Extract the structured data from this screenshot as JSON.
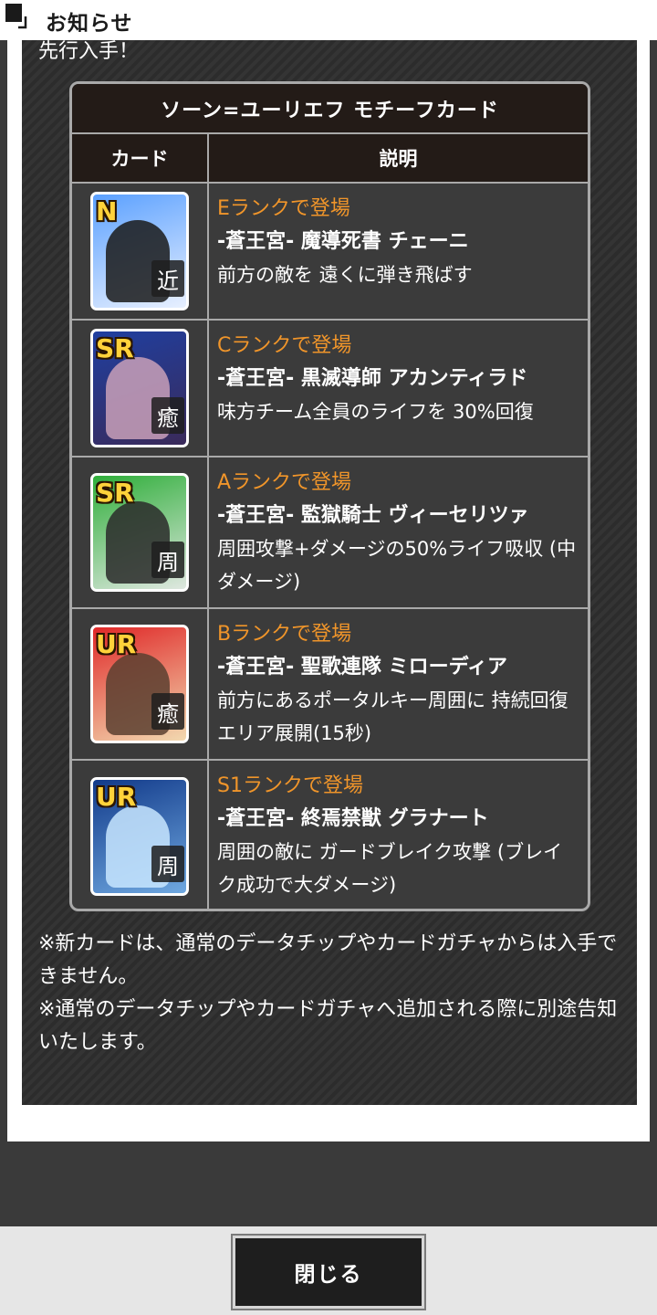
{
  "header": {
    "title": "お知らせ"
  },
  "intro_text": "先行入手！",
  "table": {
    "title": "ソーン=ユーリエフ モチーフカード",
    "columns": [
      "カード",
      "説明"
    ],
    "rows": [
      {
        "rarity": "N",
        "type": "近",
        "rank": "Eランクで登場",
        "name": "-蒼王宮- 魔導死書 チェーニ",
        "desc": "前方の敵を 遠くに弾き飛ばす",
        "colors": {
          "bg1": "#5aa0ff",
          "bg2": "#e8f0ff",
          "art": "#1a1a1a"
        }
      },
      {
        "rarity": "SR",
        "type": "癒",
        "rank": "Cランクで登場",
        "name": "-蒼王宮- 黒滅導師 アカンティラド",
        "desc": "味方チーム全員のライフを 30%回復",
        "colors": {
          "bg1": "#1f3fa0",
          "bg2": "#3a2a5a",
          "art": "#c9a0b8"
        }
      },
      {
        "rarity": "SR",
        "type": "周",
        "rank": "Aランクで登場",
        "name": "-蒼王宮- 監獄騎士 ヴィーセリツァ",
        "desc": "周囲攻撃+ダメージの50%ライフ吸収 (中ダメージ)",
        "colors": {
          "bg1": "#2fae3a",
          "bg2": "#dfe8e0",
          "art": "#2a2a2a"
        }
      },
      {
        "rarity": "UR",
        "type": "癒",
        "rank": "Bランクで登場",
        "name": "-蒼王宮- 聖歌連隊 ミローディア",
        "desc": "前方にあるポータルキー周囲に 持続回復エリア展開(15秒)",
        "colors": {
          "bg1": "#e02828",
          "bg2": "#f2d9b0",
          "art": "#5a4030"
        }
      },
      {
        "rarity": "UR",
        "type": "周",
        "rank": "S1ランクで登場",
        "name": "-蒼王宮- 終焉禁獣 グラナート",
        "desc": "周囲の敵に ガードブレイク攻撃 (ブレイク成功で大ダメージ)",
        "colors": {
          "bg1": "#123a8a",
          "bg2": "#6fa8e0",
          "art": "#c8e6ff"
        }
      }
    ]
  },
  "notes": [
    "※新カードは、通常のデータチップやカードガチャからは入手できません。",
    "※通常のデータチップやカードガチャへ追加される際に別途告知いたします。"
  ],
  "close_label": "閉じる"
}
